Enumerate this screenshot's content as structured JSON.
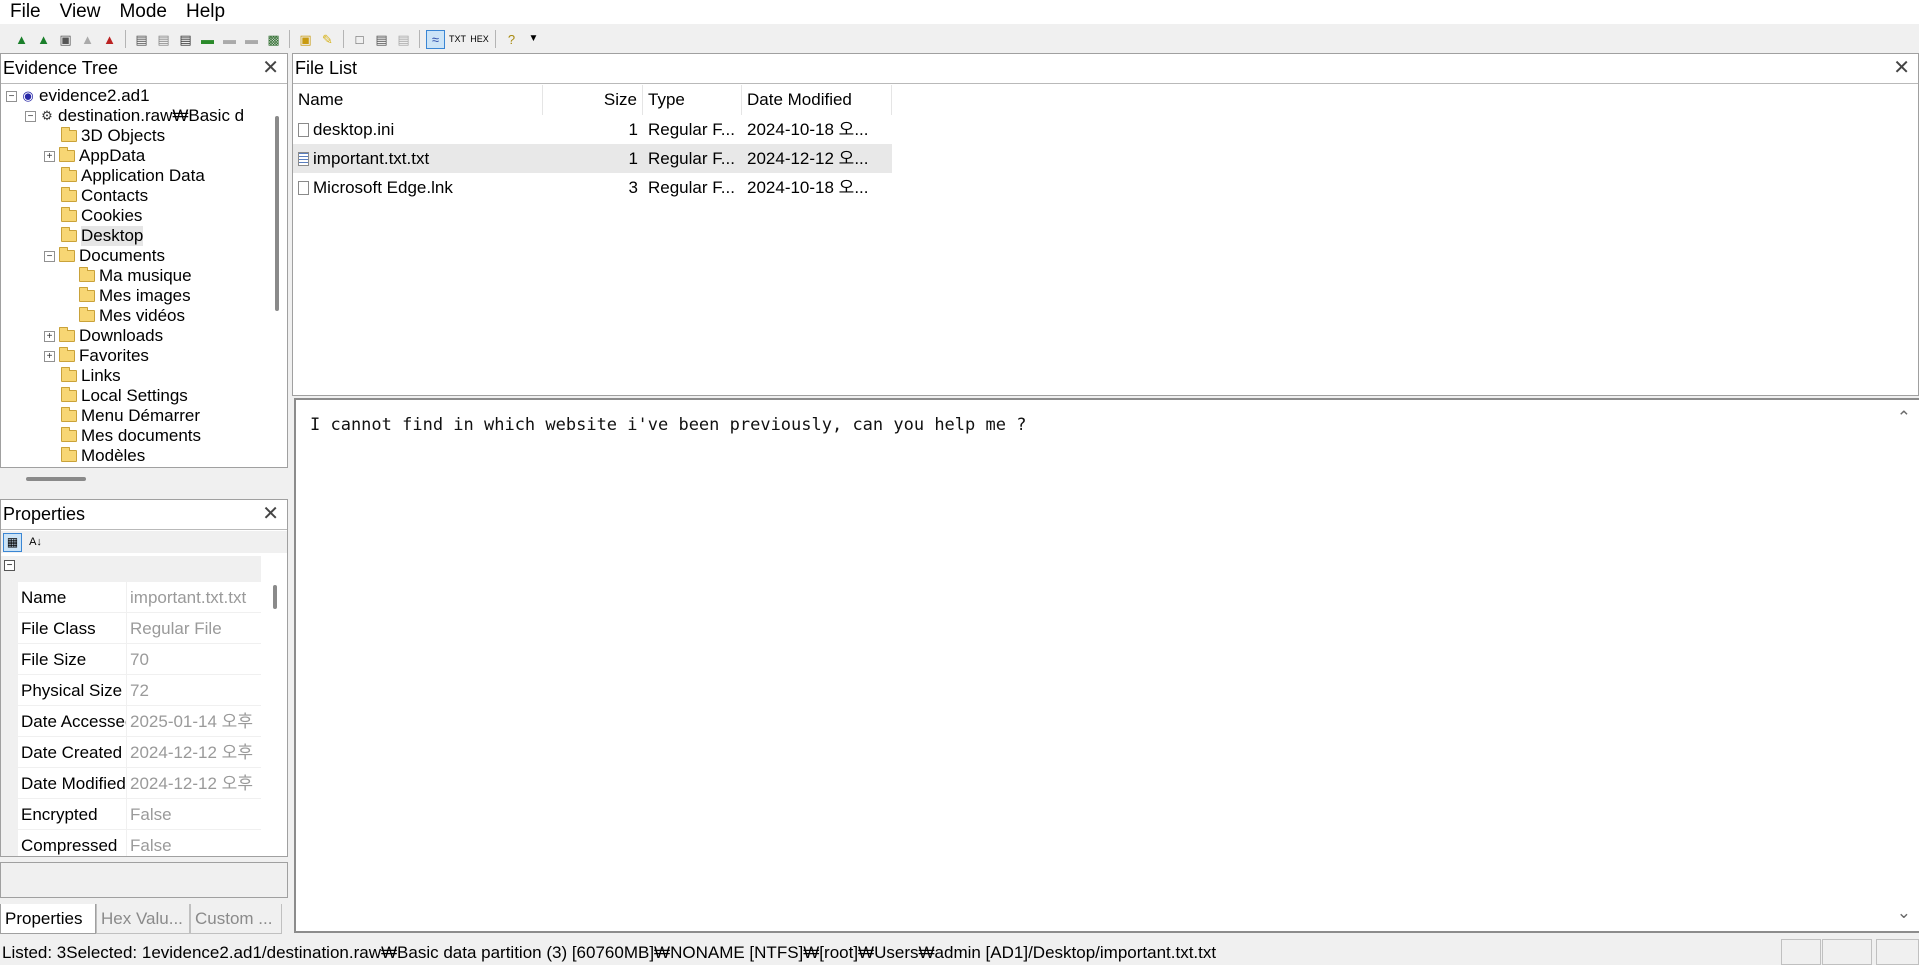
{
  "menu": [
    "File",
    "View",
    "Mode",
    "Help"
  ],
  "toolbar_icons": [
    "add-evidence-icon",
    "add-all-evidence-icon",
    "image-mounting-icon",
    "remove-evidence-icon",
    "remove-all-icon",
    "create-disk-image-icon",
    "export-files-icon",
    "export-directory-icon",
    "verify-drive-icon",
    "decrypt-icon",
    "capture-memory-icon",
    "obtain-protected-files-icon",
    "detect-encrypted-icon",
    "table-of-contents-icon",
    "export-file-hash-icon",
    "export-directory-listing-icon",
    "auto-view-icon",
    "text-view-icon",
    "hex-view-icon",
    "help-icon",
    "overflow-icon"
  ],
  "evidence_tree": {
    "title": "Evidence Tree",
    "root": "evidence2.ad1",
    "partition": "destination.raw₩Basic d",
    "folders": [
      "3D Objects",
      "AppData",
      "Application Data",
      "Contacts",
      "Cookies",
      "Desktop",
      "Documents",
      "Ma musique",
      "Mes images",
      "Mes vidéos",
      "Downloads",
      "Favorites",
      "Links",
      "Local Settings",
      "Menu Démarrer",
      "Mes documents",
      "Modèles"
    ]
  },
  "properties": {
    "title": "Properties",
    "rows": [
      {
        "key": "Name",
        "value": "important.txt.txt"
      },
      {
        "key": "File Class",
        "value": "Regular File"
      },
      {
        "key": "File Size",
        "value": "70"
      },
      {
        "key": "Physical Size",
        "value": "72"
      },
      {
        "key": "Date Accessed",
        "value": "2025-01-14 오후"
      },
      {
        "key": "Date Created",
        "value": "2024-12-12 오후"
      },
      {
        "key": "Date Modified",
        "value": "2024-12-12 오후"
      },
      {
        "key": "Encrypted",
        "value": "False"
      },
      {
        "key": "Compressed",
        "value": "False"
      }
    ],
    "tabs": [
      "Properties",
      "Hex Valu...",
      "Custom ..."
    ]
  },
  "file_list": {
    "title": "File List",
    "columns": [
      "Name",
      "Size",
      "Type",
      "Date Modified"
    ],
    "rows": [
      {
        "name": "desktop.ini",
        "size": "1",
        "type": "Regular F...",
        "date": "2024-10-18 오..."
      },
      {
        "name": "important.txt.txt",
        "size": "1",
        "type": "Regular F...",
        "date": "2024-12-12 오..."
      },
      {
        "name": "Microsoft Edge.lnk",
        "size": "3",
        "type": "Regular F...",
        "date": "2024-10-18 오..."
      }
    ]
  },
  "viewer": {
    "content": "I cannot find in which website i've been previously, can you help me ?"
  },
  "status": "Listed: 3Selected: 1evidence2.ad1/destination.raw₩Basic data partition (3) [60760MB]₩NONAME [NTFS]₩[root]₩Users₩admin [AD1]/Desktop/important.txt.txt"
}
